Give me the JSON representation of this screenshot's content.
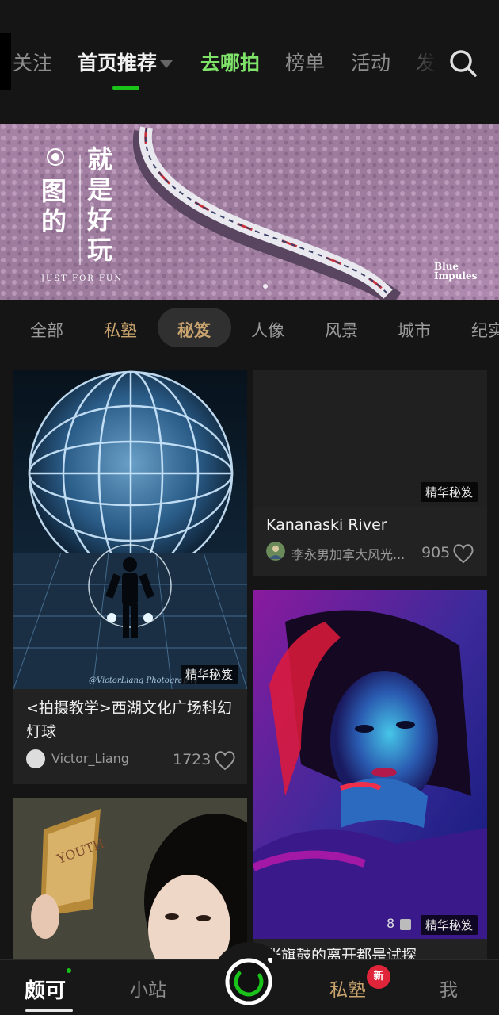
{
  "top_tabs": [
    "关注",
    "首页推荐",
    "去哪拍",
    "榜单",
    "活动",
    "发"
  ],
  "banner": {
    "title_col1": "图的",
    "title_col2": "就是好玩",
    "subtitle": "JUST FOR FUN",
    "caption_right": "Blue Impules"
  },
  "categories": [
    "全部",
    "私塾",
    "秘笈",
    "人像",
    "风景",
    "城市",
    "纪实"
  ],
  "cards": [
    {
      "title": "<拍摄教学>西湖文化广场科幻灯球",
      "author": "Victor_Liang",
      "likes": "1723",
      "badge": "精华秘笈",
      "watermark": "@VictorLiang Photography"
    },
    {
      "title": "Kananaski River",
      "author": "李永男加拿大风光...",
      "likes": "905",
      "badge": "精华秘笈"
    },
    {
      "title": "",
      "badge": ""
    },
    {
      "title": "张旗鼓的离开都是试探",
      "badge": "精华秘笈",
      "count": "8"
    }
  ],
  "bottom_nav": {
    "home": "颇可",
    "station": "小站",
    "school": "私塾",
    "school_badge": "新",
    "me": "我"
  },
  "colors": {
    "accent_green": "#19c319",
    "gold": "#c9a46e",
    "badge_red": "#e0253a",
    "background": "#151515"
  }
}
